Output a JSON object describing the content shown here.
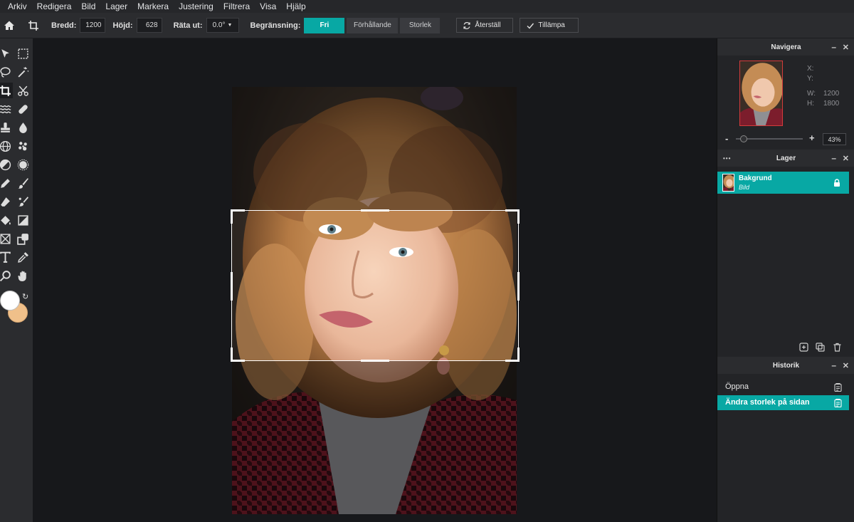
{
  "menu": [
    "Arkiv",
    "Redigera",
    "Bild",
    "Lager",
    "Markera",
    "Justering",
    "Filtrera",
    "Visa",
    "Hjälp"
  ],
  "options": {
    "width_label": "Bredd:",
    "width_value": "1200",
    "height_label": "Höjd:",
    "height_value": "628",
    "straighten_label": "Räta ut:",
    "straighten_value": "0.0°",
    "constraint_label": "Begränsning:",
    "constraint_options": [
      "Fri",
      "Förhållande",
      "Storlek"
    ],
    "constraint_selected": "Fri",
    "reset_label": "Återställ",
    "apply_label": "Tillämpa"
  },
  "colors": {
    "accent": "#08a8a4",
    "foreground": "#ffffff",
    "background": "#f0c08a"
  },
  "navigator": {
    "title": "Navigera",
    "x_label": "X:",
    "y_label": "Y:",
    "w_label": "W:",
    "w_value": "1200",
    "h_label": "H:",
    "h_value": "1800",
    "zoom_minus": "-",
    "zoom_plus": "+",
    "zoom_value": "43%",
    "zoom_fraction": 0.12
  },
  "layers": {
    "title": "Lager",
    "menu_dots": "•••",
    "items": [
      {
        "name": "Bakgrund",
        "type": "Bild",
        "locked": true
      }
    ]
  },
  "history": {
    "title": "Historik",
    "items": [
      {
        "label": "Öppna"
      },
      {
        "label": "Ändra storlek på sidan"
      }
    ],
    "selected_index": 1
  },
  "panel_controls": {
    "minimize": "–",
    "close": "✕"
  }
}
